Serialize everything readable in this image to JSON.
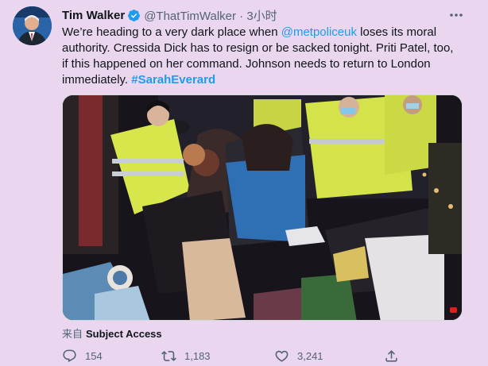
{
  "tweet": {
    "author_name": "Tim Walker",
    "handle_time": "@ThatTimWalker · 3小时",
    "text_1": "We’re heading to a very dark place when ",
    "mention": "@metpoliceuk",
    "text_2": " loses its moral authority. Cressida Dick has to resign or be sacked tonight. Priti Patel, too, if this happened on her command. Johnson needs to return to London immediately. ",
    "hashtag": "#SarahEverard",
    "source_prefix": "来自",
    "source_app": "Subject Access",
    "replies": "154",
    "retweets": "1,183",
    "likes": "3,241"
  },
  "icons": {
    "verified": "verified-badge-icon",
    "more": "more-options-icon",
    "reply": "reply-icon",
    "retweet": "retweet-icon",
    "like": "heart-icon",
    "share": "share-icon",
    "video": "video-indicator-icon"
  },
  "colors": {
    "background": "#ead7ef",
    "link": "#1d9bf0",
    "secondary_text": "#536471",
    "primary_text": "#0f1419"
  }
}
